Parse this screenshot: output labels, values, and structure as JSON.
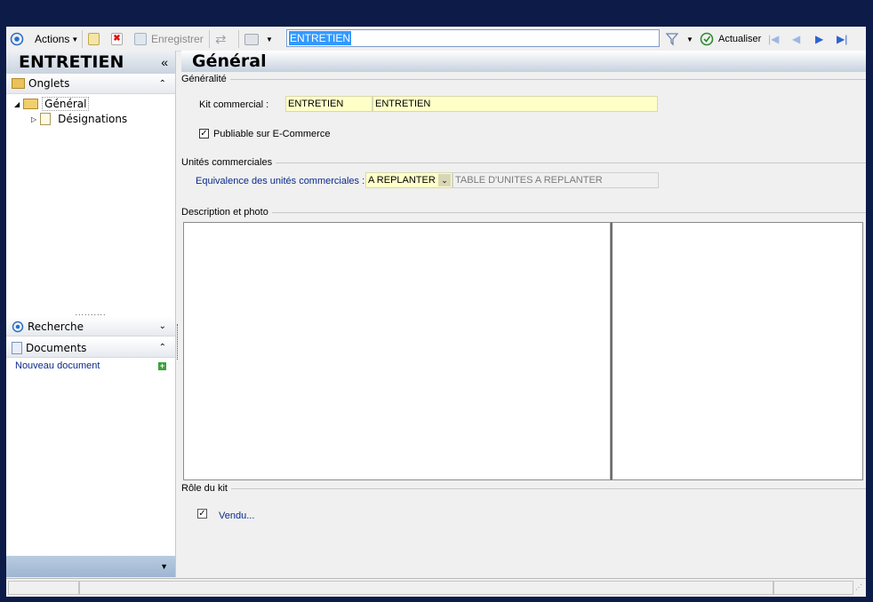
{
  "toolbar": {
    "actions_label": "Actions",
    "save_label": "Enregistrer",
    "search_value": "ENTRETIEN",
    "refresh_label": "Actualiser"
  },
  "left": {
    "title": "ENTRETIEN",
    "collapse_glyph": "«",
    "tabs_section": "Onglets",
    "tree": {
      "general": "Général",
      "designations": "Désignations"
    },
    "search_section": "Recherche",
    "documents_section": "Documents",
    "new_document": "Nouveau document"
  },
  "main": {
    "title": "Général",
    "generalite_group": "Généralité",
    "kit_label": "Kit commercial :",
    "kit_code": "ENTRETIEN",
    "kit_name": "ENTRETIEN",
    "publish_label": "Publiable sur E-Commerce",
    "units_group": "Unités commerciales",
    "equiv_label": "Equivalence des unités commerciales :",
    "equiv_value": "A REPLANTER",
    "equiv_desc": "TABLE D'UNITES  A REPLANTER",
    "desc_group": "Description et photo",
    "role_group": "Rôle du kit",
    "sold_label": "Vendu..."
  },
  "colors": {
    "background": "#0c1b47",
    "field_yellow": "#ffffc8",
    "accent": "#3399ff",
    "link": "#0a2a8a"
  },
  "icons": [
    "menu-circle-icon",
    "new-icon",
    "delete-icon",
    "save-icon",
    "refresh-arrows-icon",
    "print-icon",
    "filter-icon",
    "refresh-circle-icon",
    "first-icon",
    "prev-icon",
    "next-icon",
    "last-icon",
    "folder-icon",
    "document-icon",
    "add-icon"
  ]
}
